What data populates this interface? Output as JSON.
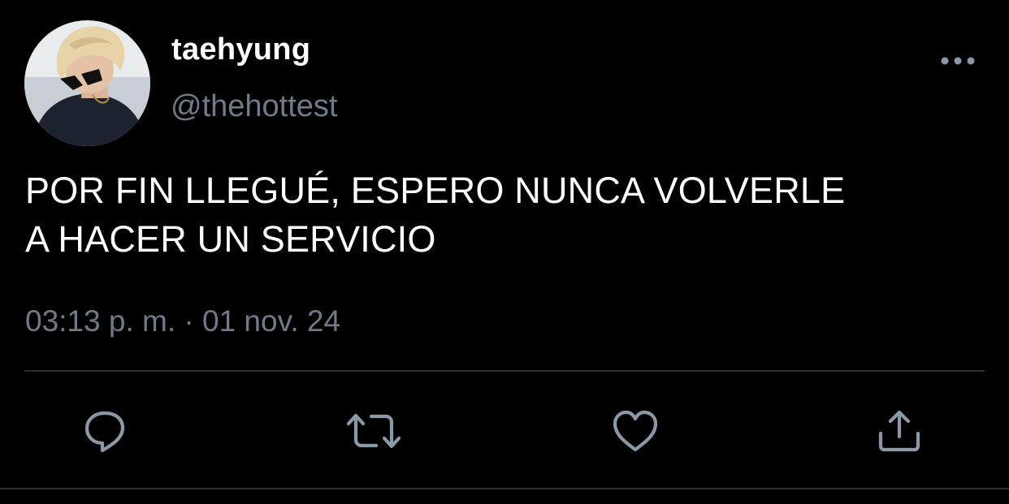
{
  "tweet": {
    "author": {
      "display_name": "taehyung",
      "handle": "@thehottest",
      "avatar_icon": "profile-photo"
    },
    "text_line_1": "POR FIN LLEGUÉ, ESPERO NUNCA VOLVERLE",
    "text_line_2": "A HACER UN SERVICIO",
    "time": "03:13 p. m.",
    "separator": " · ",
    "date": "01 nov. 24"
  },
  "actions": [
    {
      "icon": "reply-icon"
    },
    {
      "icon": "retweet-icon"
    },
    {
      "icon": "like-icon"
    },
    {
      "icon": "share-icon"
    }
  ],
  "colors": {
    "background": "#000000",
    "text": "#ffffff",
    "secondary_text": "#6e7b88",
    "icon": "#8b98a5",
    "divider": "#2a2f33"
  }
}
